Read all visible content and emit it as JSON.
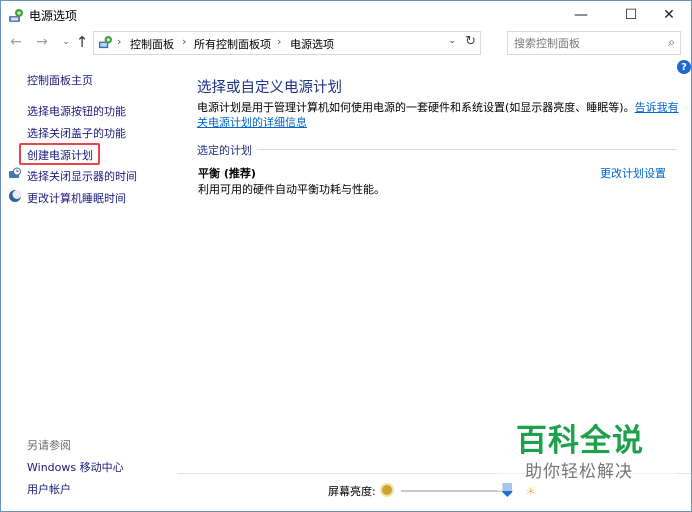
{
  "window": {
    "title": "电源选项",
    "minimize_glyph": "—",
    "maximize_glyph": "☐",
    "close_glyph": "✕"
  },
  "nav": {
    "back_glyph": "←",
    "forward_glyph": "→",
    "history_glyph": "⌄",
    "up_glyph": "↑",
    "breadcrumb": [
      "控制面板",
      "所有控制面板项",
      "电源选项"
    ],
    "separator": "›",
    "dropdown_glyph": "⌄",
    "refresh_glyph": "↻",
    "search_placeholder": "搜索控制面板",
    "search_glyph": "⌕"
  },
  "help": {
    "glyph": "?"
  },
  "sidebar": {
    "home": "控制面板主页",
    "links": [
      "选择电源按钮的功能",
      "选择关闭盖子的功能",
      "创建电源计划",
      "选择关闭显示器的时间",
      "更改计算机睡眠时间"
    ],
    "see_also_heading": "另请参阅",
    "see_also": [
      "Windows 移动中心",
      "用户帐户"
    ]
  },
  "main": {
    "title": "选择或自定义电源计划",
    "description": "电源计划是用于管理计算机如何使用电源的一套硬件和系统设置(如显示器亮度、睡眠等)。",
    "description_link": "告诉我有关电源计划的详细信息",
    "plans_heading": "选定的计划",
    "plan": {
      "name": "平衡 (推荐)",
      "description": "利用可用的硬件自动平衡功耗与性能。",
      "settings_link": "更改计划设置"
    }
  },
  "bottom": {
    "brightness_label": "屏幕亮度:",
    "brightness_level": 0.95
  },
  "watermark": {
    "title": "百科全说",
    "subtitle": "助你轻松解决"
  },
  "colors": {
    "link": "#1a1a7a",
    "heading": "#1e3287",
    "highlight_border": "#e8464a",
    "watermark_green": "#1ea14d"
  }
}
